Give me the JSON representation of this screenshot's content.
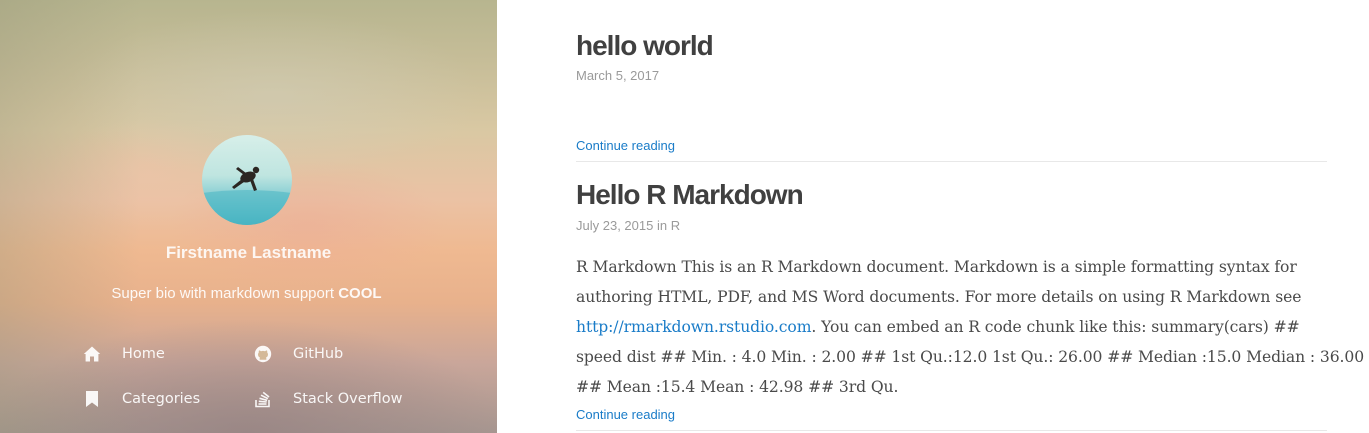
{
  "sidebar": {
    "author_name": "Firstname Lastname",
    "bio_text": "Super bio with markdown support",
    "bio_bold": "COOL",
    "nav": [
      {
        "label": "Home",
        "icon": "home-icon"
      },
      {
        "label": "GitHub",
        "icon": "github-icon"
      },
      {
        "label": "Categories",
        "icon": "bookmark-icon"
      },
      {
        "label": "Stack Overflow",
        "icon": "stack-overflow-icon"
      }
    ]
  },
  "posts": [
    {
      "title": "hello world",
      "date": "March 5, 2017",
      "continue_label": "Continue reading"
    },
    {
      "title": "Hello R Markdown",
      "date": "July 23, 2015",
      "in_label": "in",
      "category": "R",
      "excerpt": {
        "line1": "R Markdown This is an R Markdown document. Markdown is a simple formatting syntax for",
        "line2": "authoring HTML, PDF, and MS Word documents. For more details on using R Markdown see",
        "link": "http://rmarkdown.rstudio.com",
        "line3_rest": ". You can embed an R code chunk like this: summary(cars) ##",
        "line4": "speed dist ## Min. : 4.0 Min. : 2.00 ## 1st Qu.:12.0 1st Qu.: 26.00 ## Median :15.0 Median : 36.00",
        "line5": "## Mean :15.4 Mean : 42.98 ## 3rd Qu."
      },
      "continue_label": "Continue reading"
    }
  ],
  "colors": {
    "link": "#1a7cc8",
    "title": "#404040",
    "meta": "#9a9a9a"
  }
}
